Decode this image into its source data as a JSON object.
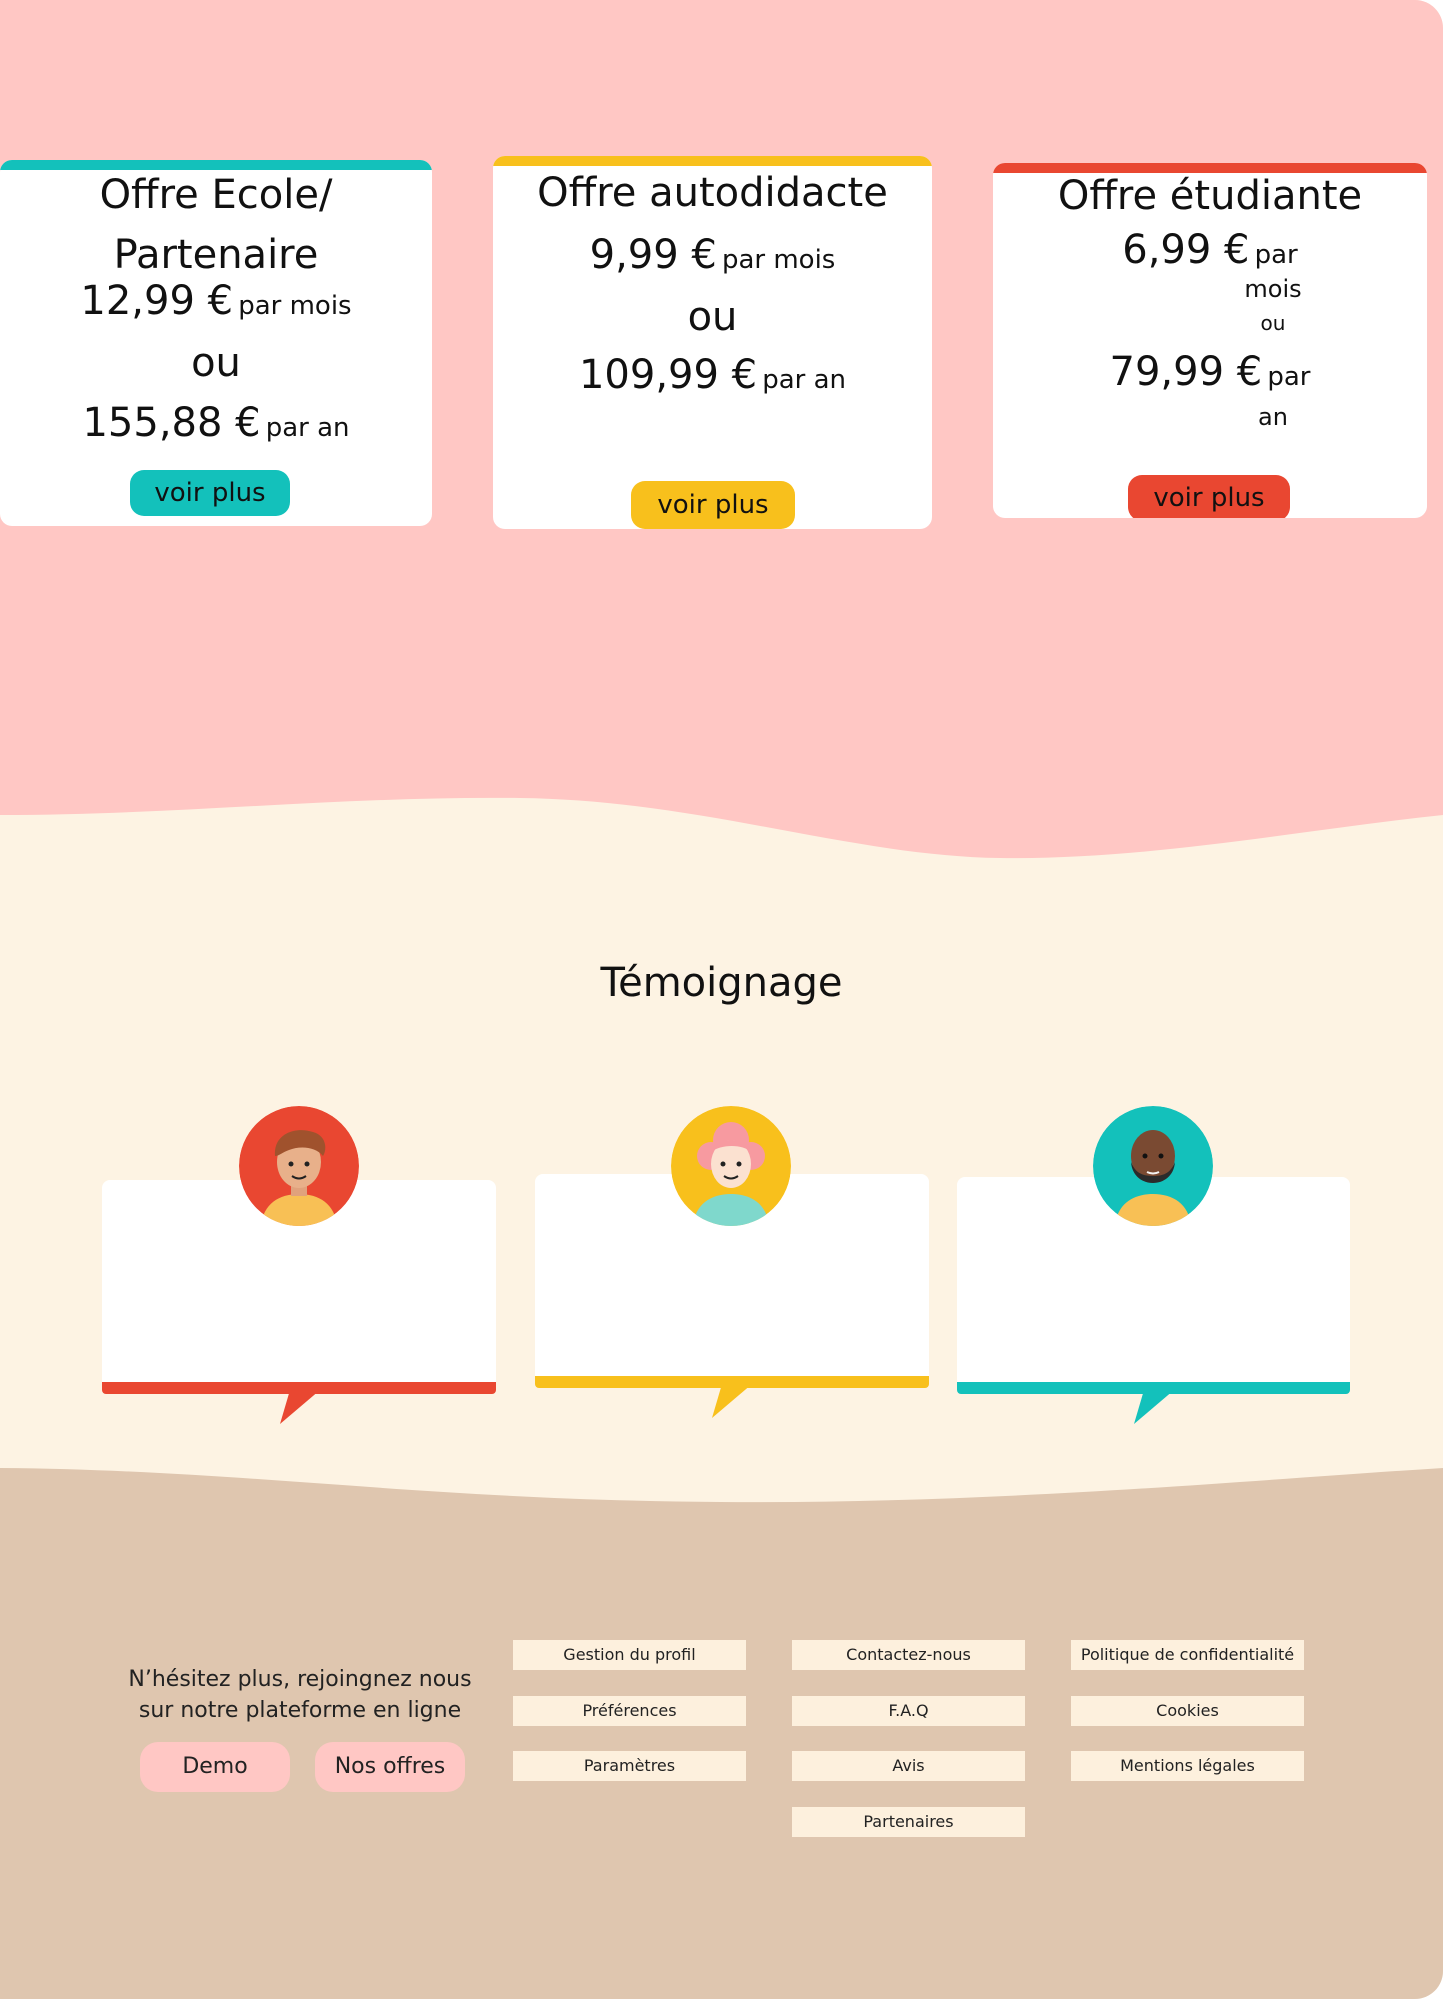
{
  "offers": [
    {
      "title_line1": "Offre Ecole/",
      "title_line2": "Partenaire",
      "monthly_price": "12,99 €",
      "monthly_suffix": "par mois",
      "or_label": "ou",
      "yearly_price": "155,88 €",
      "yearly_suffix": "par an",
      "button_label": "voir plus",
      "accent": "#13c1bb"
    },
    {
      "title_line1": "Offre autodidacte",
      "monthly_price": "9,99 €",
      "monthly_suffix": "par mois",
      "or_label": "ou",
      "yearly_price": "109,99 €",
      "yearly_suffix": "par an",
      "button_label": "voir plus",
      "accent": "#f8c01c"
    },
    {
      "title_line1": "Offre étudiante",
      "monthly_price": "6,99 €",
      "monthly_suffix_a": "par",
      "monthly_suffix_b": "mois",
      "or_label": "ou",
      "yearly_price": "79,99 €",
      "yearly_suffix_a": "par",
      "yearly_suffix_b": "an",
      "button_label": "voir plus",
      "accent": "#e94731"
    }
  ],
  "testimonials": {
    "title": "Témoignage",
    "items": [
      {
        "avatar": "man-avatar-icon",
        "accent": "#e94731"
      },
      {
        "avatar": "woman-avatar-icon",
        "accent": "#f8c01c"
      },
      {
        "avatar": "bearded-man-avatar-icon",
        "accent": "#13c1bb"
      }
    ]
  },
  "footer": {
    "cta_line1": "N’hésitez plus, rejoingnez nous",
    "cta_line2": "sur  notre plateforme en ligne",
    "demo_label": "Demo",
    "offers_label": "Nos offres",
    "col1": [
      "Gestion du profil",
      "Préférences",
      "Paramètres"
    ],
    "col2": [
      "Contactez-nous",
      "F.A.Q",
      "Avis",
      "Partenaires"
    ],
    "col3": [
      "Politique de confidentialité",
      "Cookies",
      "Mentions légales"
    ]
  },
  "colors": {
    "pink_bg": "#ffc7c4",
    "cream_bg": "#fdf3e3",
    "tan_bg": "#dfc6af",
    "teal": "#13c1bb",
    "yellow": "#f8c01c",
    "red": "#e94731"
  }
}
